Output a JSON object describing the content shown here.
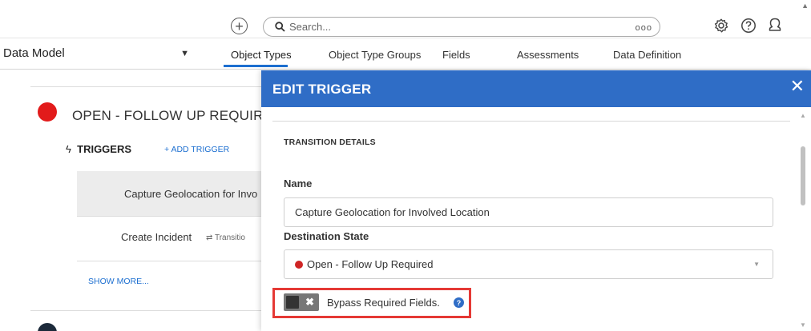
{
  "topbar": {
    "plus_icon": "plus-circle-icon",
    "search_placeholder": "Search...",
    "search_more": "ooo",
    "icons": [
      "gear-icon",
      "help-icon",
      "user-icon"
    ]
  },
  "nav": {
    "module": "Data Model",
    "tabs": [
      "Object Types",
      "Object Type Groups",
      "Fields",
      "Assessments",
      "Data Definition"
    ],
    "active_tab": "Object Types"
  },
  "background": {
    "state_title": "OPEN - FOLLOW UP REQUIRE",
    "triggers_label": "TRIGGERS",
    "add_trigger": "+ ADD TRIGGER",
    "rows": [
      {
        "name": "Capture Geolocation for Invo"
      },
      {
        "name": "Create Incident",
        "transition": "⇄ Transitio"
      }
    ],
    "show_more": "SHOW MORE..."
  },
  "modal": {
    "title": "EDIT TRIGGER",
    "section_title": "TRANSITION DETAILS",
    "name_label": "Name",
    "name_value": "Capture Geolocation for Involved Location",
    "destination_label": "Destination State",
    "destination_value": "Open - Follow Up Required",
    "bypass_label": "Bypass Required Fields.",
    "bypass_enabled": false
  },
  "colors": {
    "header_blue": "#2f6dc6",
    "link_blue": "#1d6fd0",
    "state_red": "#e21b1b",
    "highlight_red": "#e53935"
  }
}
